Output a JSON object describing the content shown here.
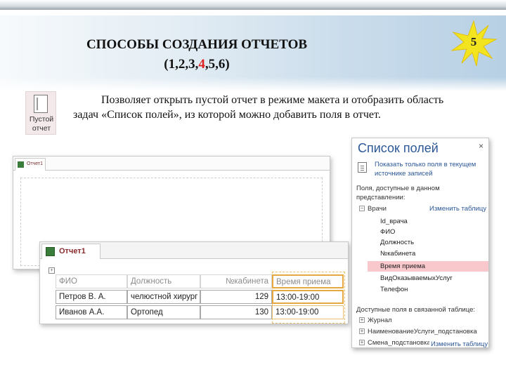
{
  "slide": {
    "title_line1": "СПОСОБЫ СОЗДАНИЯ ОТЧЕТОВ",
    "title_line2_pre": "(1,2,3,",
    "title_line2_hl": "4",
    "title_line2_post": ",5,6)",
    "badge_number": "5",
    "description": "Позволяет открыть пустой отчет в режиме макета и отобразить область задач «Список полей», из которой можно добавить поля в отчет.",
    "accent_color": "#e02020",
    "star_color": "#f2e51f"
  },
  "blank_report_button": {
    "label_line1": "Пустой",
    "label_line2": "отчет"
  },
  "back_window": {
    "tab_label": "Отчет1"
  },
  "report": {
    "tab_label": "Отчет1",
    "headers": [
      "ФИО",
      "Должность",
      "№кабинета",
      "Время приема"
    ],
    "rows": [
      [
        "Петров В. А.",
        "челюстной хирург",
        "129",
        "13:00-19:00"
      ],
      [
        "Иванов А.А.",
        "Ортопед",
        "130",
        "13:00-19:00"
      ]
    ]
  },
  "field_list": {
    "title": "Список полей",
    "close_symbol": "×",
    "show_only_link": "Показать только поля в текущем источнике записей",
    "available_label": "Поля, доступные в данном представлении:",
    "table_name": "Врачи",
    "edit_table_link": "Изменить таблицу",
    "fields": [
      "Id_врача",
      "ФИО",
      "Должность",
      "№кабинета",
      "Время приема",
      "ВидОказываемыхУслуг",
      "Телефон"
    ],
    "selected_field": "Время приема",
    "related_label": "Доступные поля в связанной таблице:",
    "related_tables": [
      "Журнал",
      "НаименованиеУслуги_подстановка",
      "Смена_подстановка"
    ],
    "related_edit_link": "Изменить таблицу"
  }
}
